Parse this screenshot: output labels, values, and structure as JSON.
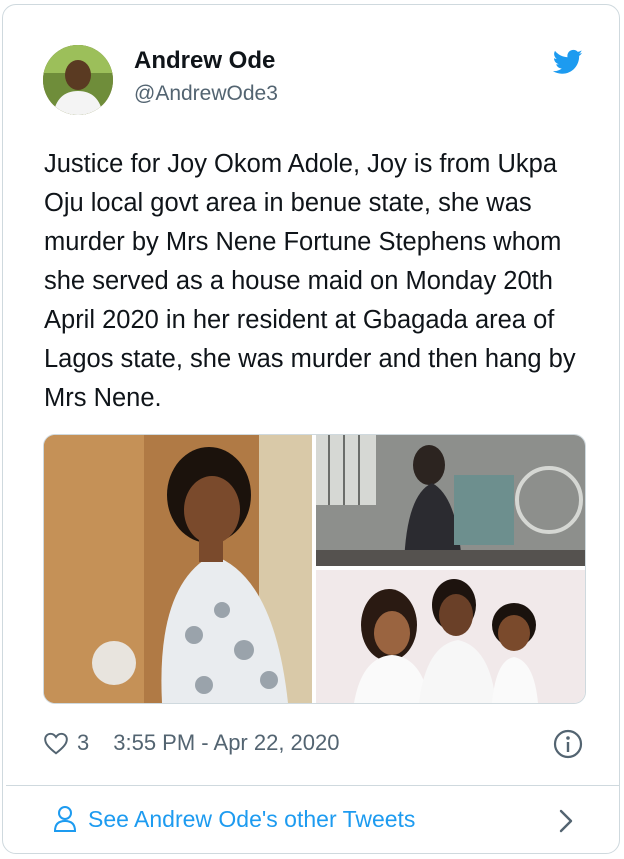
{
  "tweet": {
    "author_name": "Andrew Ode",
    "author_handle": "@AndrewOde3",
    "text": "Justice for Joy Okom Adole, Joy is from Ukpa Oju local govt area in benue state, she was murder by Mrs Nene Fortune Stephens whom she served as a house maid on Monday 20th April 2020 in her resident at Gbagada area of Lagos state, she was murder and then hang by Mrs Nene.",
    "likes": "3",
    "timestamp": "3:55 PM - Apr 22, 2020"
  },
  "footer": {
    "link_label": "See Andrew Ode's other Tweets"
  },
  "icons": {
    "brand": "twitter-bird-icon",
    "like": "heart-icon",
    "info": "info-icon",
    "profile": "person-icon",
    "more": "chevron-right-icon"
  },
  "colors": {
    "accent": "#1d9bf0",
    "secondary_text": "#536471",
    "border": "#cfd9de"
  }
}
